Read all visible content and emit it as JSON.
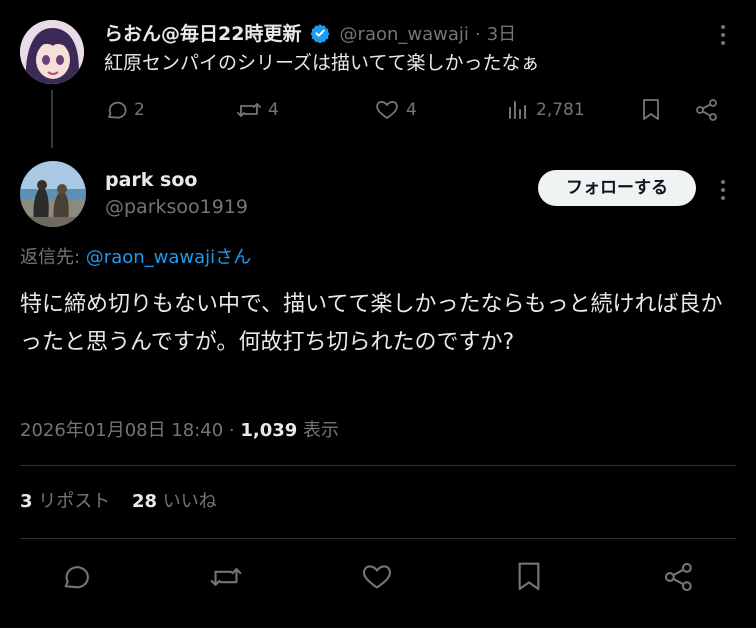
{
  "parent_tweet": {
    "display_name": "らおん@毎日22時更新",
    "handle": "@raon_wawaji",
    "separator": "·",
    "age": "3日",
    "text": "紅原センパイのシリーズは描いてて楽しかったなぁ",
    "replies": "2",
    "retweets": "4",
    "likes": "4",
    "views": "2,781"
  },
  "reply_tweet": {
    "display_name": "park soo",
    "handle": "@parksoo1919",
    "follow_label": "フォローする",
    "reply_to_prefix": "返信先: ",
    "reply_to_handle": "@raon_wawaji",
    "reply_to_suffix": "さん",
    "text": "特に締め切りもない中で、描いてて楽しかったならもっと続ければ良かったと思うんですが。何故打ち切られたのですか?",
    "timestamp": "2026年01月08日 18:40 · ",
    "view_count": "1,039",
    "view_label": " 表示"
  },
  "stats": {
    "reposts_count": "3",
    "reposts_label": " リポスト",
    "likes_count": "28",
    "likes_label": " いいね"
  },
  "colors": {
    "background": "#000000",
    "text": "#e7e9ea",
    "muted": "#71767b",
    "link": "#1d9bf0",
    "divider": "#2f3336",
    "verified": "#1d9bf0"
  },
  "icons": [
    "reply-icon",
    "retweet-icon",
    "like-icon",
    "views-icon",
    "bookmark-icon",
    "share-icon",
    "verified-badge-icon",
    "more-icon"
  ]
}
